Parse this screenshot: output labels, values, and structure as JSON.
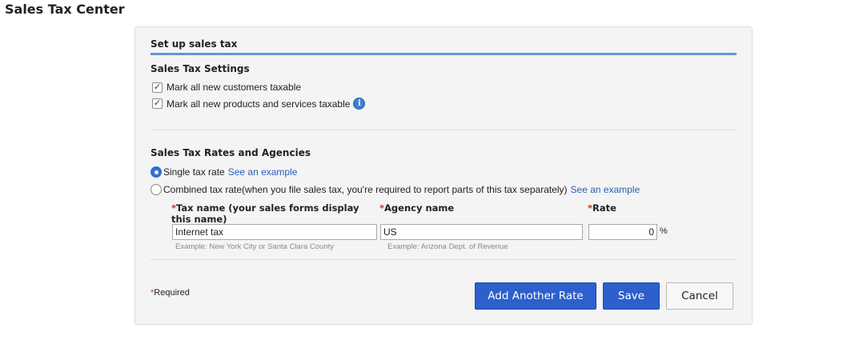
{
  "page": {
    "title": "Sales Tax Center"
  },
  "panel": {
    "header": "Set up sales tax",
    "settings": {
      "title": "Sales Tax Settings",
      "customers_taxable_label": "Mark all new customers taxable",
      "customers_taxable_checked": true,
      "products_taxable_label": "Mark all new products and services taxable",
      "products_taxable_checked": true
    },
    "rates": {
      "title": "Sales Tax Rates and Agencies",
      "single_rate_label": "Single tax rate",
      "single_rate_link": "See an example",
      "combined_rate_label": "Combined tax rate(when you file sales tax, you're required to report parts of this tax separately)",
      "combined_rate_link": "See an example",
      "selected_option": "single",
      "fields": {
        "tax_name_label": "Tax name (your sales forms display this name)",
        "tax_name_value": "Internet tax",
        "tax_name_hint": "Example: New York City or Santa Clara County",
        "agency_label": "Agency name",
        "agency_value": "US",
        "agency_hint": "Example: Arizona Dept. of Revenue",
        "rate_label": "Rate",
        "rate_value": "0",
        "rate_unit": "%",
        "required_star": "*"
      }
    },
    "footer": {
      "required_note": "Required",
      "add_rate_button": "Add Another Rate",
      "save_button": "Save",
      "cancel_button": "Cancel"
    }
  },
  "colors": {
    "primary_button": "#2d5fcd",
    "header_underline": "#5b9bd5",
    "link": "#2a5fb5",
    "required_star": "#c0392b"
  }
}
